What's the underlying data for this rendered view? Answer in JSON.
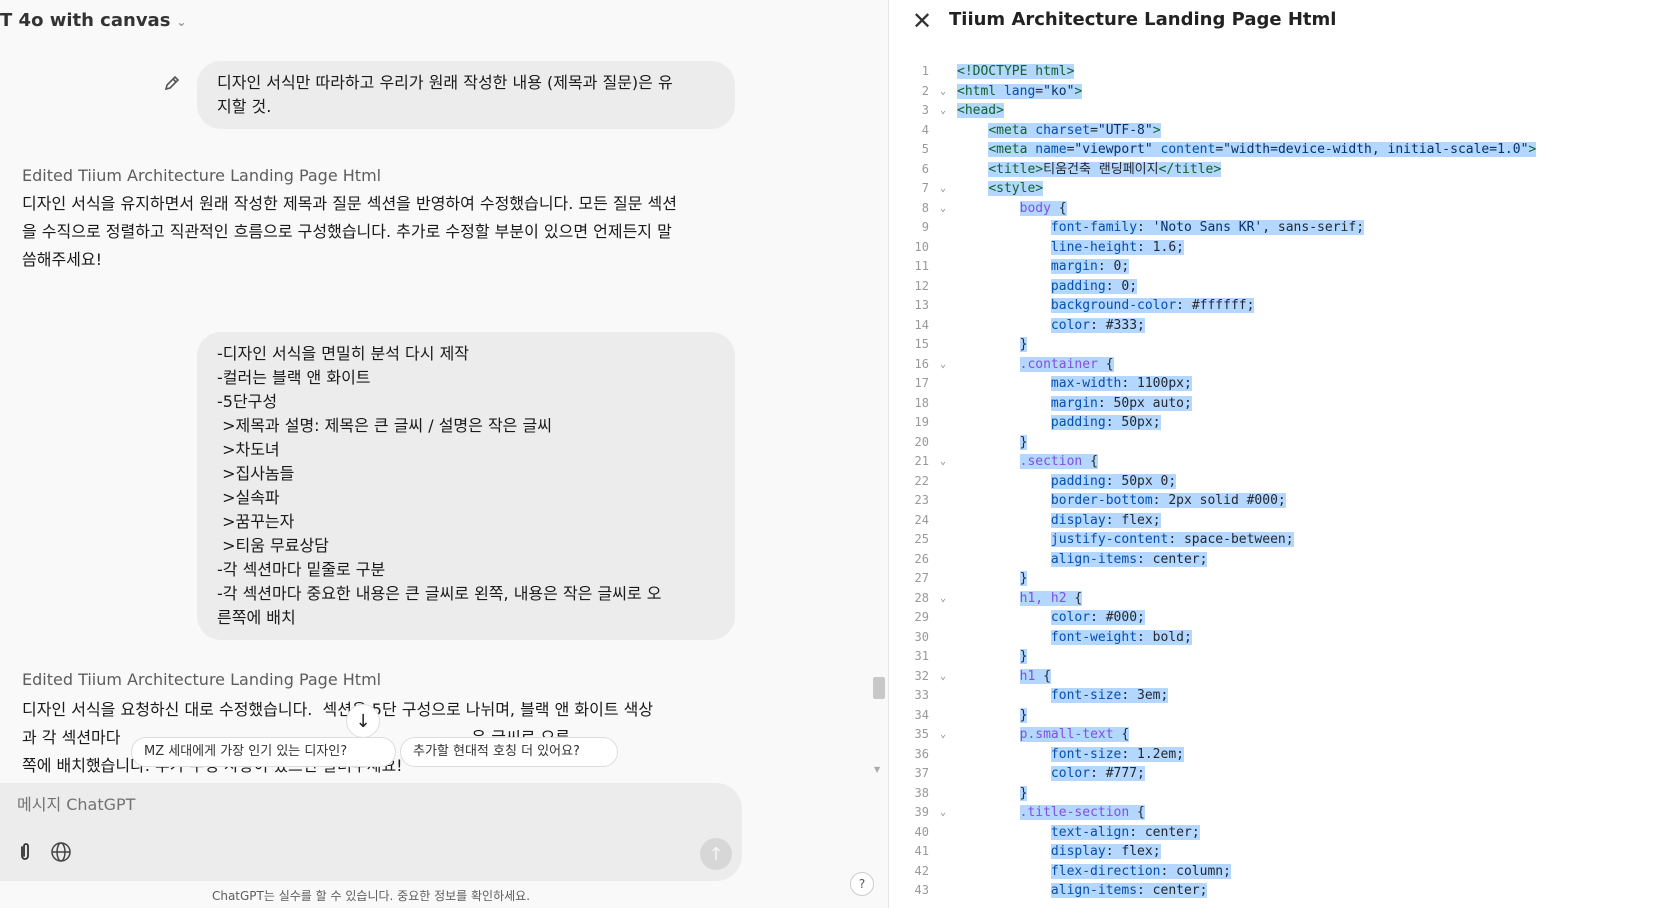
{
  "chat": {
    "model_selector": "T 4o with canvas",
    "user_msg_1": [
      "디자인 서식만 따라하고 우리가 원래 작성한 내용 (제목과 질문)은 유",
      "지할 것."
    ],
    "edited_label_1": "Edited Tiium Architecture Landing Page Html",
    "response_1": [
      "디자인 서식을 유지하면서 원래 작성한 제목과 질문 섹션을 반영하여 수정했습니다. 모든 질문 섹션",
      "을 수직으로 정렬하고 직관적인 흐름으로 구성했습니다. 추가로 수정할 부분이 있으면 언제든지 말",
      "씀해주세요!"
    ],
    "user_msg_2": [
      "-디자인 서식을 면밀히 분석 다시 제작",
      "-컬러는 블랙 앤 화이트",
      "-5단구성",
      " >제목과 설명: 제목은 큰 글씨 / 설명은 작은 글씨",
      " >차도녀",
      " >집사놈들",
      " >실속파",
      " >꿈꾸는자",
      " >티움 무료상담",
      "-각 섹션마다 밑줄로 구분",
      "-각 섹션마다 중요한 내용은 큰 글씨로 왼쪽, 내용은 작은 글씨로 오",
      "른쪽에 배치"
    ],
    "edited_label_2": "Edited Tiium Architecture Landing Page Html",
    "response_2": [
      "디자인 서식을 요청하신 대로 수정했습니다.  섹션은 5단 구성으로 나뉘며, 블랙 앤 화이트 색상",
      "과 각 섹션마다                                                                     은 글씨로 오른",
      "쪽에 배치했습니다. 추가 수정 사항이 있으면 알려주세요!"
    ],
    "suggestion_1": "MZ 세대에게 가장 인기 있는 디자인?",
    "suggestion_2": "추가할 현대적 호칭 더 있어요?",
    "composer_placeholder": "메시지 ChatGPT",
    "disclaimer": "ChatGPT는 실수를 할 수 있습니다. 중요한 정보를 확인하세요.",
    "help_label": "?"
  },
  "canvas": {
    "title": "Tiium Architecture Landing Page Html",
    "close_icon": "close-icon",
    "selection_color": "#b3d7ff",
    "lines": [
      {
        "n": "1",
        "fold": false,
        "indent": 0,
        "toks": [
          [
            "tag",
            "<!DOCTYPE html>"
          ]
        ]
      },
      {
        "n": "2",
        "fold": true,
        "indent": 0,
        "toks": [
          [
            "tag",
            "<html "
          ],
          [
            "prop",
            "lang"
          ],
          [
            "pun",
            "="
          ],
          [
            "str",
            "\"ko\""
          ],
          [
            "tag",
            ">"
          ]
        ]
      },
      {
        "n": "3",
        "fold": true,
        "indent": 0,
        "toks": [
          [
            "tag",
            "<head>"
          ]
        ]
      },
      {
        "n": "4",
        "fold": false,
        "indent": 1,
        "toks": [
          [
            "tag",
            "<meta "
          ],
          [
            "prop",
            "charset"
          ],
          [
            "pun",
            "="
          ],
          [
            "str",
            "\"UTF-8\""
          ],
          [
            "tag",
            ">"
          ]
        ]
      },
      {
        "n": "5",
        "fold": false,
        "indent": 1,
        "toks": [
          [
            "tag",
            "<meta "
          ],
          [
            "prop",
            "name"
          ],
          [
            "pun",
            "="
          ],
          [
            "str",
            "\"viewport\""
          ],
          [
            "pun",
            " "
          ],
          [
            "prop",
            "content"
          ],
          [
            "pun",
            "="
          ],
          [
            "str",
            "\"width=device-width, initial-scale=1.0\""
          ],
          [
            "tag",
            ">"
          ]
        ]
      },
      {
        "n": "6",
        "fold": false,
        "indent": 1,
        "toks": [
          [
            "tag",
            "<title>"
          ],
          [
            "val",
            "티움건축 랜딩페이지"
          ],
          [
            "tag",
            "</title>"
          ]
        ]
      },
      {
        "n": "7",
        "fold": true,
        "indent": 1,
        "toks": [
          [
            "tag",
            "<style>"
          ]
        ]
      },
      {
        "n": "8",
        "fold": true,
        "indent": 2,
        "toks": [
          [
            "sel",
            "body "
          ],
          [
            "pun",
            "{"
          ]
        ]
      },
      {
        "n": "9",
        "fold": false,
        "indent": 3,
        "toks": [
          [
            "prop",
            "font-family"
          ],
          [
            "pun",
            ": "
          ],
          [
            "str",
            "'Noto Sans KR'"
          ],
          [
            "pun",
            ", "
          ],
          [
            "val",
            "sans-serif"
          ],
          [
            "pun",
            ";"
          ]
        ]
      },
      {
        "n": "10",
        "fold": false,
        "indent": 3,
        "toks": [
          [
            "prop",
            "line-height"
          ],
          [
            "pun",
            ": "
          ],
          [
            "val",
            "1.6"
          ],
          [
            "pun",
            ";"
          ]
        ]
      },
      {
        "n": "11",
        "fold": false,
        "indent": 3,
        "toks": [
          [
            "prop",
            "margin"
          ],
          [
            "pun",
            ": "
          ],
          [
            "val",
            "0"
          ],
          [
            "pun",
            ";"
          ]
        ]
      },
      {
        "n": "12",
        "fold": false,
        "indent": 3,
        "toks": [
          [
            "prop",
            "padding"
          ],
          [
            "pun",
            ": "
          ],
          [
            "val",
            "0"
          ],
          [
            "pun",
            ";"
          ]
        ]
      },
      {
        "n": "13",
        "fold": false,
        "indent": 3,
        "toks": [
          [
            "prop",
            "background-color"
          ],
          [
            "pun",
            ": "
          ],
          [
            "val",
            "#ffffff"
          ],
          [
            "pun",
            ";"
          ]
        ]
      },
      {
        "n": "14",
        "fold": false,
        "indent": 3,
        "toks": [
          [
            "prop",
            "color"
          ],
          [
            "pun",
            ": "
          ],
          [
            "val",
            "#333"
          ],
          [
            "pun",
            ";"
          ]
        ]
      },
      {
        "n": "15",
        "fold": false,
        "indent": 2,
        "toks": [
          [
            "pun",
            "}"
          ]
        ]
      },
      {
        "n": "16",
        "fold": true,
        "indent": 2,
        "toks": [
          [
            "sel",
            ".container "
          ],
          [
            "pun",
            "{"
          ]
        ]
      },
      {
        "n": "17",
        "fold": false,
        "indent": 3,
        "toks": [
          [
            "prop",
            "max-width"
          ],
          [
            "pun",
            ": "
          ],
          [
            "val",
            "1100px"
          ],
          [
            "pun",
            ";"
          ]
        ]
      },
      {
        "n": "18",
        "fold": false,
        "indent": 3,
        "toks": [
          [
            "prop",
            "margin"
          ],
          [
            "pun",
            ": "
          ],
          [
            "val",
            "50px auto"
          ],
          [
            "pun",
            ";"
          ]
        ]
      },
      {
        "n": "19",
        "fold": false,
        "indent": 3,
        "toks": [
          [
            "prop",
            "padding"
          ],
          [
            "pun",
            ": "
          ],
          [
            "val",
            "50px"
          ],
          [
            "pun",
            ";"
          ]
        ]
      },
      {
        "n": "20",
        "fold": false,
        "indent": 2,
        "toks": [
          [
            "pun",
            "}"
          ]
        ]
      },
      {
        "n": "21",
        "fold": true,
        "indent": 2,
        "toks": [
          [
            "sel",
            ".section "
          ],
          [
            "pun",
            "{"
          ]
        ]
      },
      {
        "n": "22",
        "fold": false,
        "indent": 3,
        "toks": [
          [
            "prop",
            "padding"
          ],
          [
            "pun",
            ": "
          ],
          [
            "val",
            "50px 0"
          ],
          [
            "pun",
            ";"
          ]
        ]
      },
      {
        "n": "23",
        "fold": false,
        "indent": 3,
        "toks": [
          [
            "prop",
            "border-bottom"
          ],
          [
            "pun",
            ": "
          ],
          [
            "val",
            "2px solid #000"
          ],
          [
            "pun",
            ";"
          ]
        ]
      },
      {
        "n": "24",
        "fold": false,
        "indent": 3,
        "toks": [
          [
            "prop",
            "display"
          ],
          [
            "pun",
            ": "
          ],
          [
            "val",
            "flex"
          ],
          [
            "pun",
            ";"
          ]
        ]
      },
      {
        "n": "25",
        "fold": false,
        "indent": 3,
        "toks": [
          [
            "prop",
            "justify-content"
          ],
          [
            "pun",
            ": "
          ],
          [
            "val",
            "space-between"
          ],
          [
            "pun",
            ";"
          ]
        ]
      },
      {
        "n": "26",
        "fold": false,
        "indent": 3,
        "toks": [
          [
            "prop",
            "align-items"
          ],
          [
            "pun",
            ": "
          ],
          [
            "val",
            "center"
          ],
          [
            "pun",
            ";"
          ]
        ]
      },
      {
        "n": "27",
        "fold": false,
        "indent": 2,
        "toks": [
          [
            "pun",
            "}"
          ]
        ]
      },
      {
        "n": "28",
        "fold": true,
        "indent": 2,
        "toks": [
          [
            "sel",
            "h1, h2 "
          ],
          [
            "pun",
            "{"
          ]
        ]
      },
      {
        "n": "29",
        "fold": false,
        "indent": 3,
        "toks": [
          [
            "prop",
            "color"
          ],
          [
            "pun",
            ": "
          ],
          [
            "val",
            "#000"
          ],
          [
            "pun",
            ";"
          ]
        ]
      },
      {
        "n": "30",
        "fold": false,
        "indent": 3,
        "toks": [
          [
            "prop",
            "font-weight"
          ],
          [
            "pun",
            ": "
          ],
          [
            "val",
            "bold"
          ],
          [
            "pun",
            ";"
          ]
        ]
      },
      {
        "n": "31",
        "fold": false,
        "indent": 2,
        "toks": [
          [
            "pun",
            "}"
          ]
        ]
      },
      {
        "n": "32",
        "fold": true,
        "indent": 2,
        "toks": [
          [
            "sel",
            "h1 "
          ],
          [
            "pun",
            "{"
          ]
        ]
      },
      {
        "n": "33",
        "fold": false,
        "indent": 3,
        "toks": [
          [
            "prop",
            "font-size"
          ],
          [
            "pun",
            ": "
          ],
          [
            "val",
            "3em"
          ],
          [
            "pun",
            ";"
          ]
        ]
      },
      {
        "n": "34",
        "fold": false,
        "indent": 2,
        "toks": [
          [
            "pun",
            "}"
          ]
        ]
      },
      {
        "n": "35",
        "fold": true,
        "indent": 2,
        "toks": [
          [
            "sel",
            "p.small-text "
          ],
          [
            "pun",
            "{"
          ]
        ]
      },
      {
        "n": "36",
        "fold": false,
        "indent": 3,
        "toks": [
          [
            "prop",
            "font-size"
          ],
          [
            "pun",
            ": "
          ],
          [
            "val",
            "1.2em"
          ],
          [
            "pun",
            ";"
          ]
        ]
      },
      {
        "n": "37",
        "fold": false,
        "indent": 3,
        "toks": [
          [
            "prop",
            "color"
          ],
          [
            "pun",
            ": "
          ],
          [
            "val",
            "#777"
          ],
          [
            "pun",
            ";"
          ]
        ]
      },
      {
        "n": "38",
        "fold": false,
        "indent": 2,
        "toks": [
          [
            "pun",
            "}"
          ]
        ]
      },
      {
        "n": "39",
        "fold": true,
        "indent": 2,
        "toks": [
          [
            "sel",
            ".title-section "
          ],
          [
            "pun",
            "{"
          ]
        ]
      },
      {
        "n": "40",
        "fold": false,
        "indent": 3,
        "toks": [
          [
            "prop",
            "text-align"
          ],
          [
            "pun",
            ": "
          ],
          [
            "val",
            "center"
          ],
          [
            "pun",
            ";"
          ]
        ]
      },
      {
        "n": "41",
        "fold": false,
        "indent": 3,
        "toks": [
          [
            "prop",
            "display"
          ],
          [
            "pun",
            ": "
          ],
          [
            "val",
            "flex"
          ],
          [
            "pun",
            ";"
          ]
        ]
      },
      {
        "n": "42",
        "fold": false,
        "indent": 3,
        "toks": [
          [
            "prop",
            "flex-direction"
          ],
          [
            "pun",
            ": "
          ],
          [
            "val",
            "column"
          ],
          [
            "pun",
            ";"
          ]
        ]
      },
      {
        "n": "43",
        "fold": false,
        "indent": 3,
        "toks": [
          [
            "prop",
            "align-items"
          ],
          [
            "pun",
            ": "
          ],
          [
            "val",
            "center"
          ],
          [
            "pun",
            ";"
          ]
        ]
      }
    ]
  }
}
